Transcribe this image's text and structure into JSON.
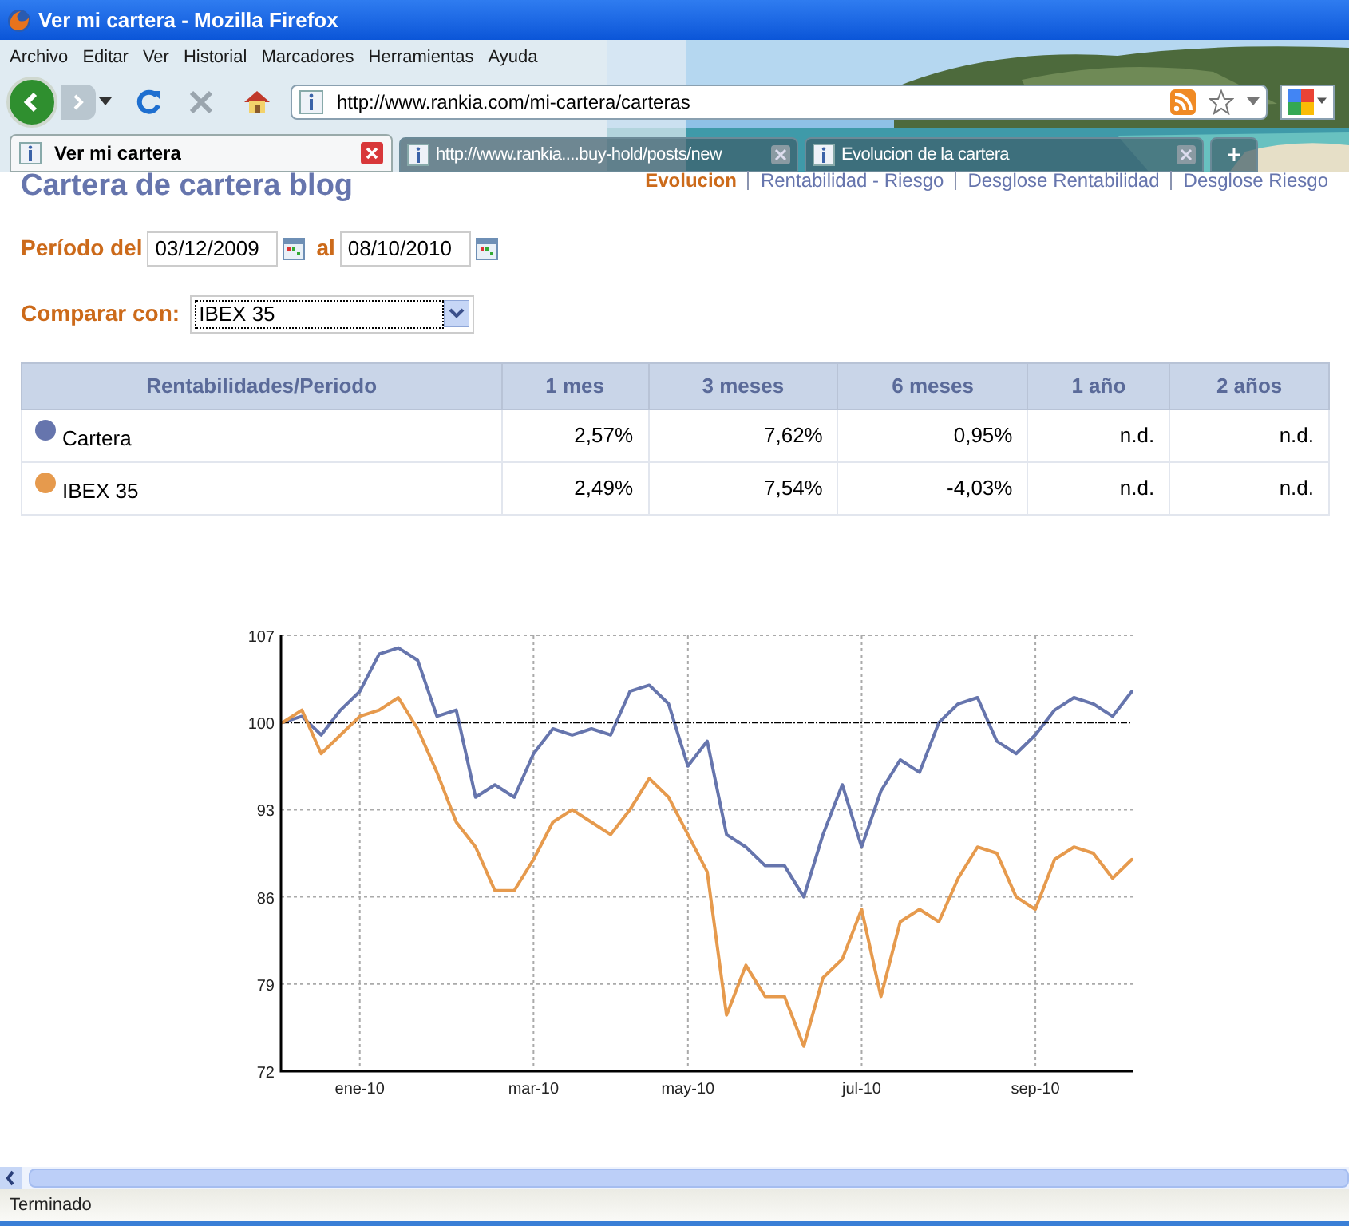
{
  "window": {
    "title": "Ver mi cartera - Mozilla Firefox"
  },
  "menu": [
    "Archivo",
    "Editar",
    "Ver",
    "Historial",
    "Marcadores",
    "Herramientas",
    "Ayuda"
  ],
  "address_bar": {
    "url": "http://www.rankia.com/mi-cartera/carteras"
  },
  "tabs": [
    {
      "label": "Ver mi cartera",
      "selected": true
    },
    {
      "label": "http://www.rankia....buy-hold/posts/new",
      "selected": false
    },
    {
      "label": "Evolucion de la cartera",
      "selected": false
    }
  ],
  "page": {
    "title": "Cartera de cartera blog",
    "nav_links": [
      {
        "label": "Evolucion",
        "selected": true
      },
      {
        "label": "Rentabilidad - Riesgo",
        "selected": false
      },
      {
        "label": "Desglose Rentabilidad",
        "selected": false
      },
      {
        "label": "Desglose Riesgo",
        "selected": false
      }
    ],
    "period": {
      "label_from": "Período del",
      "from": "03/12/2009",
      "label_to": "al",
      "to": "08/10/2010"
    },
    "compare": {
      "label": "Comparar con:",
      "value": "IBEX 35"
    },
    "table": {
      "columns": [
        "Rentabilidades/Periodo",
        "1 mes",
        "3 meses",
        "6 meses",
        "1 año",
        "2 años"
      ],
      "rows": [
        {
          "color": "#6675ad",
          "cells": [
            "Cartera",
            "2,57%",
            "7,62%",
            "0,95%",
            "n.d.",
            "n.d."
          ]
        },
        {
          "color": "#e69a4d",
          "cells": [
            "IBEX 35",
            "2,49%",
            "7,54%",
            "-4,03%",
            "n.d.",
            "n.d."
          ]
        }
      ]
    },
    "chart_data": {
      "type": "line",
      "categories": [
        null,
        null,
        null,
        null,
        "ene-10",
        null,
        null,
        null,
        null,
        null,
        null,
        null,
        null,
        "mar-10",
        null,
        null,
        null,
        null,
        null,
        null,
        null,
        "may-10",
        null,
        null,
        null,
        null,
        null,
        null,
        null,
        null,
        "jul-10",
        null,
        null,
        null,
        null,
        null,
        null,
        null,
        null,
        "sep-10",
        null,
        null,
        null,
        null,
        null
      ],
      "series": [
        {
          "color": "#6675ad",
          "values": [
            100,
            100.5,
            99,
            101,
            102.5,
            105.5,
            106,
            105,
            100.5,
            101,
            94,
            95,
            94,
            97.5,
            99.5,
            99,
            99.5,
            99,
            102.5,
            103,
            101.5,
            96.5,
            98.5,
            91,
            90,
            88.5,
            88.5,
            86,
            91,
            95,
            90,
            94.5,
            97,
            96,
            100,
            101.5,
            102,
            98.5,
            97.5,
            99,
            101,
            102,
            101.5,
            100.5,
            102.5
          ]
        },
        {
          "color": "#000000",
          "line_style": "dashdot",
          "values": [
            100,
            100,
            100,
            100,
            100,
            100,
            100,
            100,
            100,
            100,
            100,
            100,
            100,
            100,
            100,
            100,
            100,
            100,
            100,
            100,
            100,
            100,
            100,
            100,
            100,
            100,
            100,
            100,
            100,
            100,
            100,
            100,
            100,
            100,
            100,
            100,
            100,
            100,
            100,
            100,
            100,
            100,
            100,
            100,
            100
          ]
        },
        {
          "color": "#e69a4d",
          "values": [
            100,
            101,
            97.5,
            99,
            100.5,
            101,
            102,
            99.5,
            96,
            92,
            90,
            86.5,
            86.5,
            89,
            92,
            93,
            92,
            91,
            93,
            95.5,
            94,
            91,
            88,
            76.5,
            80.5,
            78,
            78,
            74,
            79.5,
            81,
            85,
            78,
            84,
            85,
            84,
            87.5,
            90,
            89.5,
            86,
            85,
            89,
            90,
            89.5,
            87.5,
            89
          ]
        }
      ],
      "ylim": [
        72,
        107
      ],
      "yticks": [
        72,
        79,
        86,
        93,
        100,
        107
      ],
      "grid": true
    }
  },
  "status_bar": {
    "text": "Terminado"
  }
}
